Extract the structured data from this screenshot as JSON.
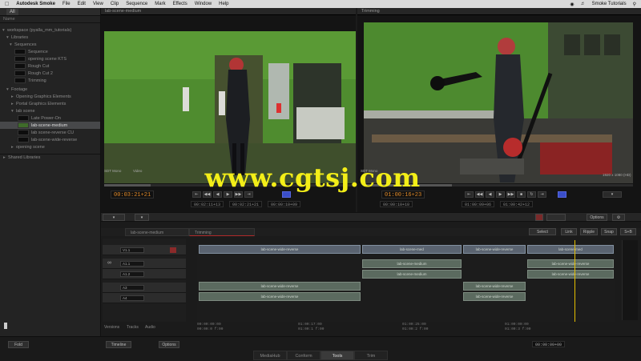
{
  "menubar": {
    "app": "Autodesk Smoke",
    "items": [
      "File",
      "Edit",
      "View",
      "Clip",
      "Sequence",
      "Mark",
      "Effects",
      "Window",
      "Help"
    ],
    "right_label": "Smoke Tutorials"
  },
  "browser": {
    "tab": "All",
    "column": "Name",
    "workspace": "workspace (pyalla_mm_tutorials)",
    "libraries_label": "Libraries",
    "sequences_label": "Sequences",
    "sequence_items": [
      "Sequence",
      "opening scene KTS",
      "Rough Cut",
      "Rough Cut 2",
      "Trimming"
    ],
    "footage_label": "Footage",
    "footage_items": [
      "Opening Graphics Elements",
      "Portal Graphics Elements",
      "lab scene"
    ],
    "lab_items": [
      "Late Power-On",
      "lab-scene-medium",
      "lab scene-reverse CU",
      "lab-scene-wide-reverse"
    ],
    "opening_scene": "opening scene",
    "shared": "Shared Libraries"
  },
  "viewer_left": {
    "title": "lab-scene-medium",
    "timecode": "00:03:21+21",
    "tc_in": "00:02:11+13",
    "tc_out": "00:02:21+21",
    "tc_dur": "00:00:10+09",
    "meta_left": "SDT Mono",
    "meta_right": "Video"
  },
  "viewer_right": {
    "title": "Trimming",
    "timecode": "01:00:16+23",
    "tc_src": "00:00:10+10",
    "tc_rec": "01:00:09+06",
    "tc_rec2": "01:00:42+12",
    "meta_left": "SDT Mono",
    "meta_right": "1920 x 1080 (HD)"
  },
  "watermark": "www.cgtsj.com",
  "timeline": {
    "tabs": [
      "lab-scene-medium",
      "Trimming"
    ],
    "track_labels": [
      "V1.1",
      "A1.1",
      "A1.2",
      "A3",
      "A4"
    ],
    "clips": {
      "v1": "lab-scene-wide-reverse",
      "v2": "lab-scene-med",
      "v3": "lab-scene-wide-reverse",
      "v4": "lab-scene-med",
      "a1": "lab-scene-wide-reverse",
      "a2": "lab-scene-medium",
      "a3": "lab-scene-wide-reverse",
      "a4": "lab-scene-medium",
      "a5": "lab-scene-wide-reverse",
      "a6": "lab-scene-wide-reverse"
    },
    "ruler": [
      "00:00:00:00",
      "01:00:17:00",
      "01:00:25:00",
      "01:00:00:00"
    ],
    "ruler2": [
      "00:00:0 f:00",
      "01:00:1 f:00",
      "01:00:2 f:00",
      "01:00:3 f:00"
    ],
    "tools": [
      "Select",
      "Link",
      "Ripple",
      "Snap",
      "S+B"
    ],
    "views": [
      "Versions",
      "Tracks",
      "Audio"
    ],
    "options": "Options"
  },
  "bottom": {
    "tabs": [
      "MediaHub",
      "Conform",
      "Tools",
      "Trim"
    ],
    "active_tab": "Tools",
    "left": "Fold",
    "timeline": "Timeline",
    "options": "Options",
    "tc": "00:00:00+00"
  },
  "colors": {
    "green_screen": "#4a8a2e",
    "timecode": "#e08a2a",
    "watermark": "#f3ee18"
  }
}
